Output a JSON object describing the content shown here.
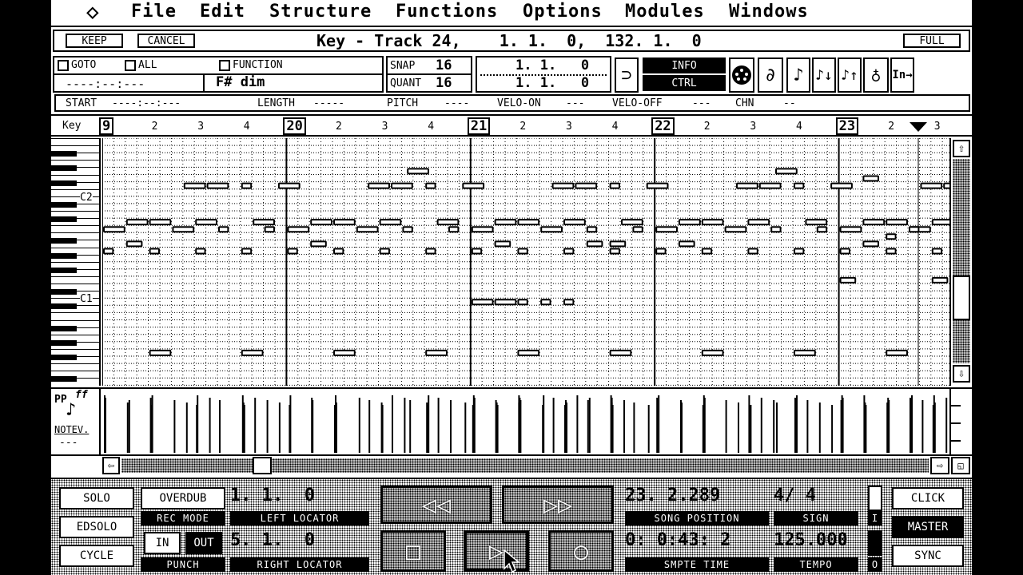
{
  "menubar": {
    "logo_glyph": "◇",
    "items": [
      "File",
      "Edit",
      "Structure",
      "Functions",
      "Options",
      "Modules",
      "Windows"
    ]
  },
  "titlebar": {
    "keep": "KEEP",
    "cancel": "CANCEL",
    "title": "Key - Track 24,    1. 1.  0,  132. 1.  0",
    "full": "FULL"
  },
  "toolbar": {
    "goto": "GOTO",
    "all": "ALL",
    "function": "FUNCTION",
    "time_field": "----:--:---",
    "chord": "F# dim",
    "snap_label": "SNAP",
    "snap_value": "16",
    "quant_label": "QUANT",
    "quant_value": "16",
    "pos_top": "1. 1.   0",
    "pos_bottom": "1. 1.   0",
    "info": "INFO",
    "ctrl": "CTRL",
    "in_arrow": "In→"
  },
  "event_info": {
    "start_label": "START",
    "start_value": "----:--:---",
    "length_label": "LENGTH",
    "length_value": "-----",
    "pitch_label": "PITCH",
    "pitch_value": "----",
    "velo_on_label": "VELO-ON",
    "velo_on_value": "---",
    "velo_off_label": "VELO-OFF",
    "velo_off_value": "---",
    "chn_label": "CHN",
    "chn_value": "--"
  },
  "ruler": {
    "key_label": "Key",
    "marks": [
      {
        "text": "9",
        "bar": true
      },
      {
        "text": "2",
        "bar": false
      },
      {
        "text": "3",
        "bar": false
      },
      {
        "text": "4",
        "bar": false
      },
      {
        "text": "20",
        "bar": true
      },
      {
        "text": "2",
        "bar": false
      },
      {
        "text": "3",
        "bar": false
      },
      {
        "text": "4",
        "bar": false
      },
      {
        "text": "21",
        "bar": true
      },
      {
        "text": "2",
        "bar": false
      },
      {
        "text": "3",
        "bar": false
      },
      {
        "text": "4",
        "bar": false
      },
      {
        "text": "22",
        "bar": true
      },
      {
        "text": "2",
        "bar": false
      },
      {
        "text": "3",
        "bar": false
      },
      {
        "text": "4",
        "bar": false
      },
      {
        "text": "23",
        "bar": true
      },
      {
        "text": "2",
        "bar": false
      },
      {
        "text": "3",
        "bar": false
      }
    ]
  },
  "keyboard": {
    "c2": "C2",
    "c1": "C1"
  },
  "velocity": {
    "pp": "PP",
    "ff": "ff",
    "label": "NOTEV.",
    "value": "---"
  },
  "transport": {
    "solo": "SOLO",
    "edsolo": "EDSOLO",
    "cycle": "CYCLE",
    "overdub": "OVERDUB",
    "rec_mode": "REC MODE",
    "in": "IN",
    "out": "OUT",
    "punch": "PUNCH",
    "left_locator_value": "1. 1.  0",
    "left_locator": "LEFT LOCATOR",
    "right_locator_value": "5. 1.  0",
    "right_locator": "RIGHT LOCATOR",
    "song_position_value": "23. 2.289",
    "song_position": "SONG POSITION",
    "smpte_value": "0: 0:43: 2",
    "smpte": "SMPTE TIME",
    "sign_value": "4/ 4",
    "sign": "SIGN",
    "tempo_value": "125.000",
    "tempo": "TEMPO",
    "i_label": "I",
    "o_label": "O",
    "click": "CLICK",
    "master": "MASTER",
    "sync": "SYNC"
  }
}
